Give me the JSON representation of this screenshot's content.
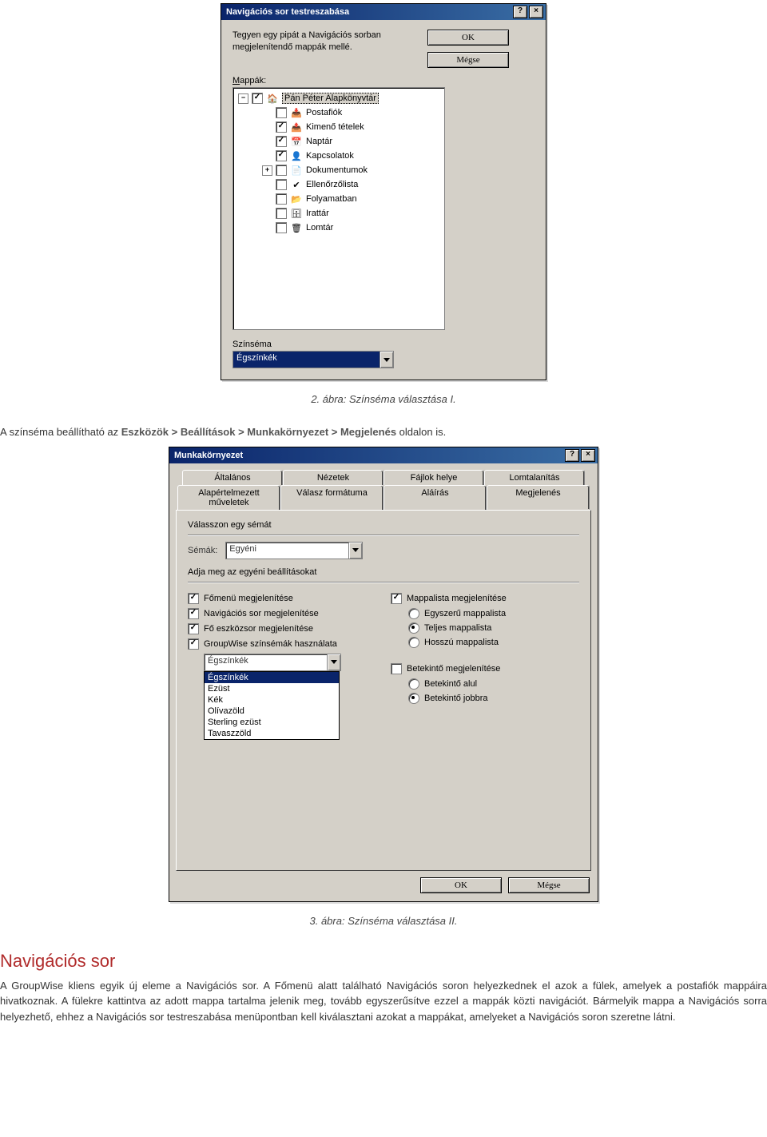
{
  "dlg1": {
    "title": "Navigációs sor testreszabása",
    "help": "?",
    "close": "×",
    "intro": "Tegyen egy pipát a Navigációs sorban megjelenítendő mappák mellé.",
    "ok": "OK",
    "cancel": "Mégse",
    "folders_label_pre": "M",
    "folders_label_post": "appák:",
    "tree": [
      {
        "exp": "−",
        "chk": "✓",
        "icon": "🏠",
        "label": "Pán Péter Alapkönyvtár",
        "sel": true,
        "indent": 0
      },
      {
        "exp": "",
        "chk": "",
        "icon": "📥",
        "label": "Postafiók",
        "indent": 1
      },
      {
        "exp": "",
        "chk": "✓",
        "icon": "📤",
        "label": "Kimenő tételek",
        "indent": 1
      },
      {
        "exp": "",
        "chk": "✓",
        "icon": "📅",
        "label": "Naptár",
        "indent": 1
      },
      {
        "exp": "",
        "chk": "✓",
        "icon": "👤",
        "label": "Kapcsolatok",
        "indent": 1
      },
      {
        "exp": "+",
        "chk": "",
        "icon": "📄",
        "label": "Dokumentumok",
        "indent": 1
      },
      {
        "exp": "",
        "chk": "",
        "icon": "✔",
        "label": "Ellenőrzőlista",
        "indent": 1
      },
      {
        "exp": "",
        "chk": "",
        "icon": "📂",
        "label": "Folyamatban",
        "indent": 1
      },
      {
        "exp": "",
        "chk": "",
        "icon": "🗄",
        "label": "Irattár",
        "indent": 1
      },
      {
        "exp": "",
        "chk": "",
        "icon": "🗑",
        "label": "Lomtár",
        "indent": 1
      }
    ],
    "scheme_label": "Színséma",
    "scheme_value": "Égszínkék"
  },
  "caption1": "2. ábra: Színséma választása I.",
  "para1_pre": "A színséma beállítható az ",
  "para1_path": "Eszközök > Beállítások > Munkakörnyezet > Megjelenés",
  "para1_post": " oldalon is.",
  "dlg2": {
    "title": "Munkakörnyezet",
    "help": "?",
    "close": "×",
    "tabs_back": [
      "Általános",
      "Nézetek",
      "Fájlok helye",
      "Lomtalanítás"
    ],
    "tabs_front": [
      "Alapértelmezett műveletek",
      "Válasz formátuma",
      "Aláírás",
      "Megjelenés"
    ],
    "group1": "Válasszon egy sémát",
    "schemes_label": "Sémák:",
    "schemes_value": "Egyéni",
    "group2": "Adja meg az egyéni beállításokat",
    "left_checks": [
      {
        "chk": "✓",
        "label": "Főmenü megjelenítése"
      },
      {
        "chk": "✓",
        "label": "Navigációs sor megjelenítése"
      },
      {
        "chk": "✓",
        "label": "Fő eszközsor megjelenítése"
      },
      {
        "chk": "✓",
        "label": "GroupWise színsémák használata"
      }
    ],
    "scheme_combo": "Égszínkék",
    "scheme_options": [
      "Égszínkék",
      "Ezüst",
      "Kék",
      "Olívazöld",
      "Sterling ezüst",
      "Tavaszzöld"
    ],
    "right_check1": {
      "chk": "✓",
      "label": "Mappalista megjelenítése"
    },
    "right_radios1": [
      {
        "on": false,
        "label": "Egyszerű mappalista"
      },
      {
        "on": true,
        "label": "Teljes mappalista"
      },
      {
        "on": false,
        "label": "Hosszú mappalista"
      }
    ],
    "right_check2": {
      "chk": "",
      "label": "Betekintő megjelenítése"
    },
    "right_radios2": [
      {
        "on": false,
        "label": "Betekintő alul"
      },
      {
        "on": true,
        "label": "Betekintő jobbra"
      }
    ],
    "ok": "OK",
    "cancel": "Mégse"
  },
  "caption2": "3. ábra: Színséma választása II.",
  "heading": "Navigációs sor",
  "p2a": "A GroupWise kliens egyik új eleme a Navigációs sor. A Főmenü alatt található Navigációs soron helyezkednek el azok a fülek, amelyek a postafiók mappáira hivatkoznak. A fülekre kattintva az adott mappa tartalma jelenik meg, tovább egyszerűsítve ezzel a mappák közti navigációt. Bármelyik mappa a Navigációs sorra helyezhető, ehhez a Navigációs sor testreszabása menüpontban kell kiválasztani azokat a mappákat, amelyeket a Navigációs soron szeretne látni."
}
